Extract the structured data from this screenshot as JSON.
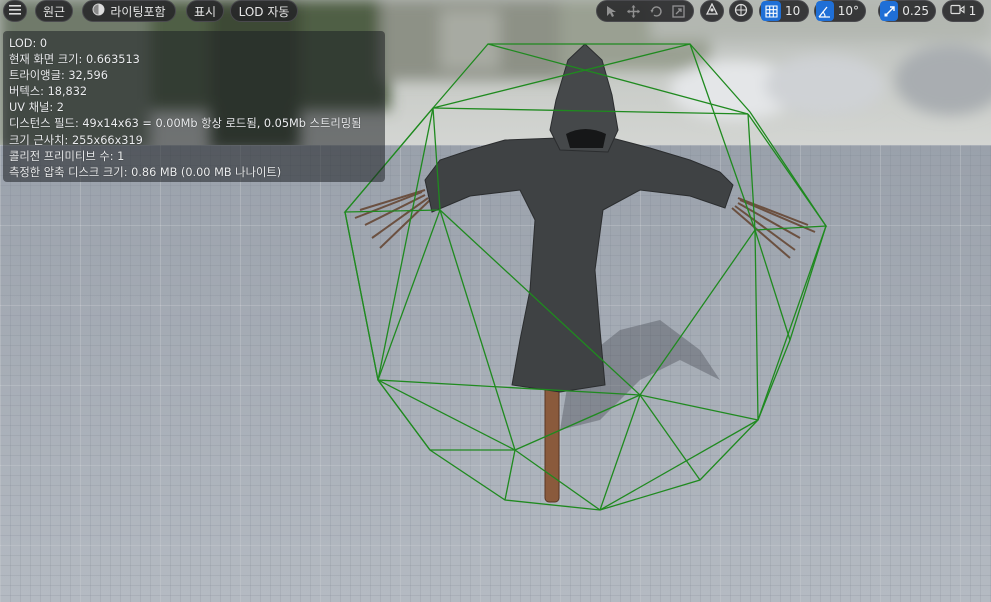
{
  "toolbar": {
    "menu_icon": "hamburger-menu-icon",
    "perspective_label": "원근",
    "lighting_label": "라이팅포함",
    "show_label": "표시",
    "lod_label": "LOD 자동",
    "grid_snap_value": "10",
    "rotation_snap_value": "10°",
    "scale_snap_value": "0.25",
    "camera_speed_value": "1",
    "accent_color": "#1f6fd6"
  },
  "stats": {
    "lines": [
      "LOD:  0",
      "현재 화면 크기: 0.663513",
      "트라이앵글: 32,596",
      "버텍스: 18,832",
      "UV 채널:  2",
      "디스턴스 필드:  49x14x63 = 0.00Mb 항상 로드됨, 0.05Mb 스트리밍됨",
      "크기 근사치: 255x66x319",
      "콜리전 프리미티브 수: 1",
      "측정한 압축 디스크 크기: 0.86 MB (0.00 MB 나나이트)"
    ]
  },
  "scene": {
    "collision_color": "#1f8a1f",
    "cloth_color": "#3f4244"
  }
}
